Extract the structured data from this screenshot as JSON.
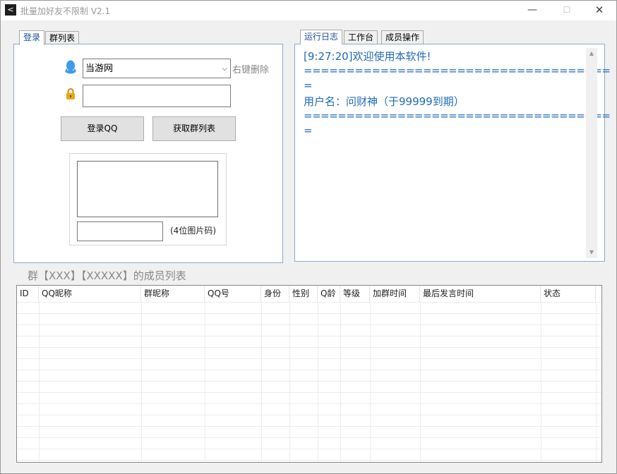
{
  "window": {
    "title": "批量加好友不限制 V2.1",
    "app_icon_glyph": "<",
    "minimize": "—",
    "maximize": "☐",
    "close": "✕"
  },
  "left_tabs": [
    "登录",
    "群列表"
  ],
  "login": {
    "account_value": "当游网",
    "right_click_hint": "右键删除",
    "password_value": "",
    "login_button": "登录QQ",
    "get_groups_button": "获取群列表",
    "captcha_input_value": "",
    "captcha_hint": "(4位图片码)"
  },
  "right_tabs": [
    "运行日志",
    "工作台",
    "成员操作"
  ],
  "log": {
    "lines": [
      "[9:27:20]欢迎使用本软件!",
      "====================================",
      "=",
      "用户名：问财神（于99999到期）",
      "====================================",
      "="
    ],
    "scroll_up": "▲",
    "scroll_down": "▼"
  },
  "member_list": {
    "title": "群【XXX】【XXXXX】的成员列表",
    "columns": [
      "ID",
      "QQ昵称",
      "群昵称",
      "QQ号",
      "身份",
      "性别",
      "Q龄",
      "等级",
      "加群时间",
      "最后发言时间",
      "状态"
    ]
  },
  "colors": {
    "accent_tab": "#1e4e9e",
    "log_text": "#1e6bb8",
    "panel_border": "#8faac8",
    "window_bg": "#f0f0f0",
    "qq_icon": "#3d9be9",
    "lock_icon": "#e8a812"
  },
  "icons": {
    "qq": "qq-penguin-icon",
    "lock": "lock-icon",
    "dropdown": "chevron-down-icon"
  }
}
